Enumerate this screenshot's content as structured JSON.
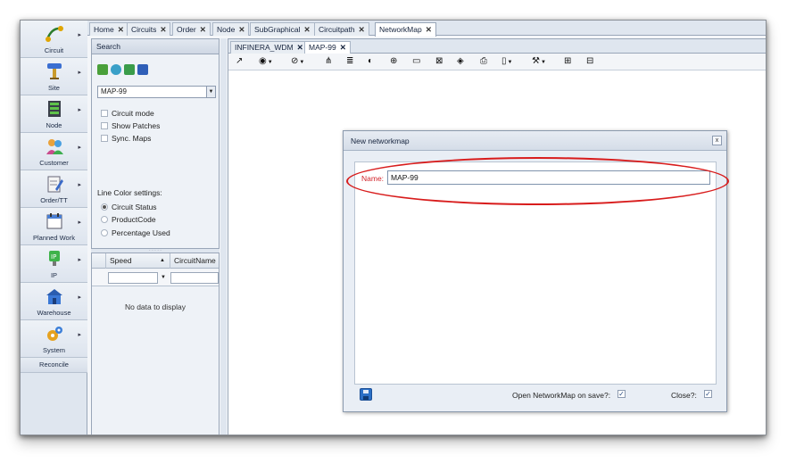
{
  "nav": [
    {
      "label": "Circuit",
      "icon": "circuit-icon"
    },
    {
      "label": "Site",
      "icon": "site-icon"
    },
    {
      "label": "Node",
      "icon": "node-icon"
    },
    {
      "label": "Customer",
      "icon": "customer-icon"
    },
    {
      "label": "Order/TT",
      "icon": "order-icon"
    },
    {
      "label": "Planned Work",
      "icon": "calendar-icon"
    },
    {
      "label": "IP",
      "icon": "ip-icon"
    },
    {
      "label": "Warehouse",
      "icon": "warehouse-icon"
    },
    {
      "label": "System",
      "icon": "system-gear-icon"
    },
    {
      "label": "Reconcile"
    }
  ],
  "top_tabs": [
    "Home",
    "Circuits",
    "Order",
    "Node",
    "SubGraphical",
    "Circuitpath",
    "NetworkMap"
  ],
  "search": {
    "title": "Search",
    "map_value": "MAP-99",
    "checkboxes": [
      "Circuit mode",
      "Show Patches",
      "Sync. Maps"
    ],
    "line_color_label": "Line Color settings:",
    "radios": [
      "Circuit Status",
      "ProductCode",
      "Percentage Used"
    ],
    "radio_selected": "Circuit Status"
  },
  "grid": {
    "columns": [
      "Speed",
      "CircuitName"
    ],
    "sort_icon": "▲",
    "empty": "No data to display"
  },
  "sub_tabs": [
    "INFINERA_WDM",
    "MAP-99"
  ],
  "toolbar": {
    "items": [
      "external-link-icon",
      "eye-icon",
      "eye-hide-icon",
      "hierarchy-icon",
      "database-icon",
      "circle-arrow-icon",
      "circle-plus-icon",
      "window-icon",
      "close-box-icon",
      "cube-icon",
      "print-icon",
      "document-icon",
      "wrench-icon",
      "zoom-in-icon",
      "zoom-out-icon"
    ]
  },
  "dialog": {
    "title": "New networkmap",
    "close": "x",
    "name_label": "Name:",
    "name_value": "MAP-99",
    "open_on_save_label": "Open NetworkMap on save?:",
    "close_label": "Close?:",
    "check_mark": "✓"
  },
  "colors": {
    "accent": "#2a6fc6",
    "highlight_ring": "#d81c1c",
    "required_label": "#d2242a"
  }
}
